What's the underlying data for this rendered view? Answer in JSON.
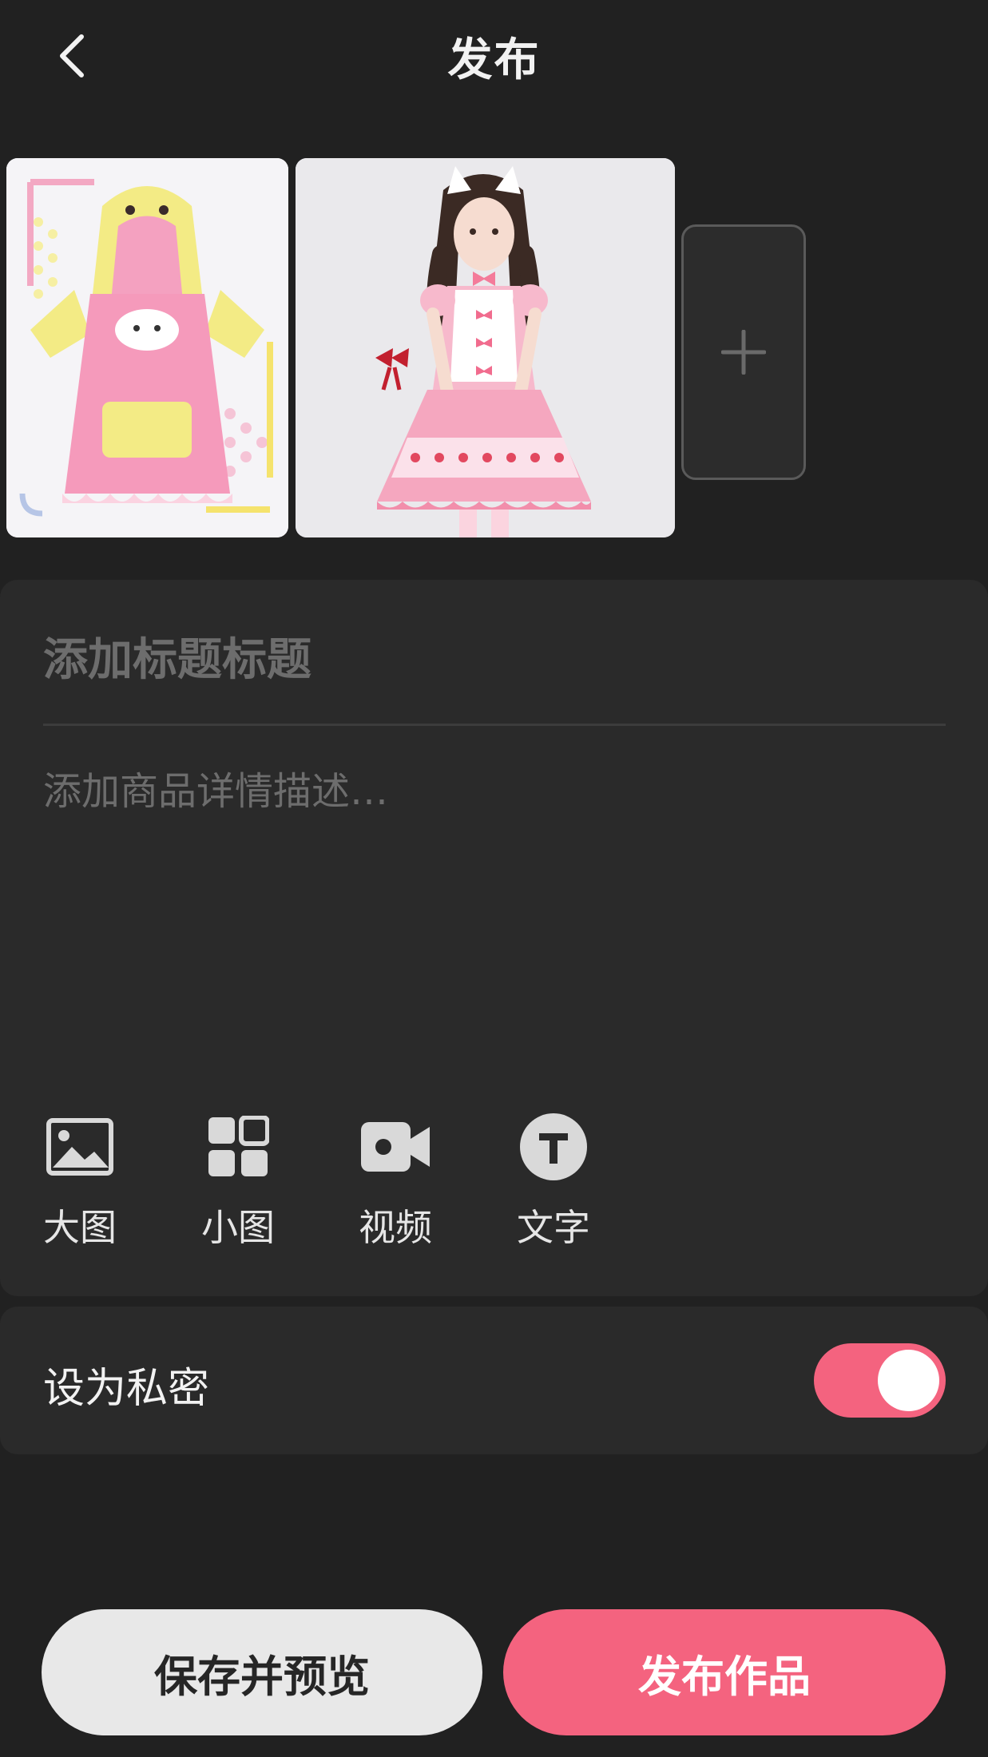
{
  "header": {
    "title": "发布",
    "back_icon": "chevron-left-icon"
  },
  "media": {
    "items": [
      {
        "name": "pink-hoodie-dress-photo"
      },
      {
        "name": "lolita-maid-dress-photo"
      }
    ],
    "add_icon": "plus-icon"
  },
  "editor": {
    "title_placeholder": "添加标题标题",
    "description_placeholder": "添加商品详情描述…",
    "tools": [
      {
        "label": "大图",
        "icon": "image-icon"
      },
      {
        "label": "小图",
        "icon": "grid-icon"
      },
      {
        "label": "视频",
        "icon": "video-camera-icon"
      },
      {
        "label": "文字",
        "icon": "text-icon"
      }
    ]
  },
  "privacy": {
    "label": "设为私密",
    "enabled": true,
    "accent": "#f4637f"
  },
  "actions": {
    "save_preview_label": "保存并预览",
    "publish_label": "发布作品"
  },
  "colors": {
    "background": "#212121",
    "card": "#2a2a2a",
    "accent": "#f4637f",
    "secondary_button": "#e8e8e8"
  }
}
